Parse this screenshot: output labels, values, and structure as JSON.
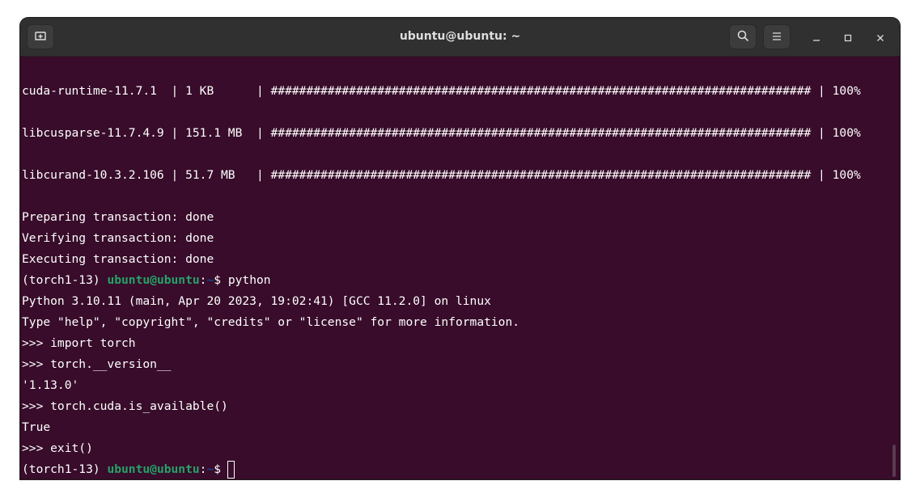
{
  "window": {
    "title": "ubuntu@ubuntu: ~"
  },
  "icons": {
    "new_tab": "new-tab-icon",
    "search": "search-icon",
    "menu": "hamburger-menu-icon",
    "minimize": "minimize-icon",
    "maximize": "maximize-icon",
    "close": "close-icon"
  },
  "colors": {
    "terminal_bg": "#380c2a",
    "titlebar_bg": "#303030",
    "prompt_user": "#26a269",
    "prompt_path": "#12488b",
    "text": "#ffffff"
  },
  "terminal": {
    "lines": [
      "cuda-runtime-11.7.1  | 1 KB      | ############################################################################ | 100%",
      "libcusparse-11.7.4.9 | 151.1 MB  | ############################################################################ | 100%",
      "libcurand-10.3.2.106 | 51.7 MB   | ############################################################################ | 100%",
      "Preparing transaction: done",
      "Verifying transaction: done",
      "Executing transaction: done",
      "Python 3.10.11 (main, Apr 20 2023, 19:02:41) [GCC 11.2.0] on linux",
      "Type \"help\", \"copyright\", \"credits\" or \"license\" for more information.",
      ">>> import torch",
      ">>> torch.__version__",
      "'1.13.0'",
      ">>> torch.cuda.is_available()",
      "True",
      ">>> exit()"
    ],
    "prompt1": {
      "env": "(torch1-13) ",
      "user": "ubuntu@ubuntu",
      "sep": ":",
      "path": "~",
      "sign": "$ ",
      "command": "python"
    },
    "prompt2": {
      "env": "(torch1-13) ",
      "user": "ubuntu@ubuntu",
      "sep": ":",
      "path": "~",
      "sign": "$"
    }
  }
}
